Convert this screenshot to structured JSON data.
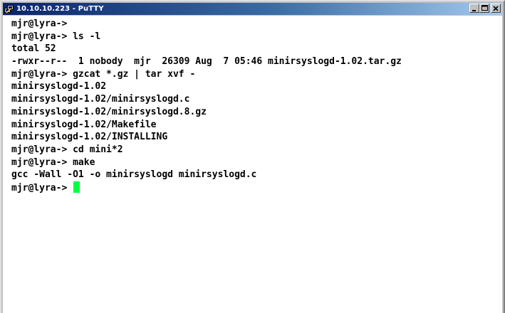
{
  "window": {
    "title": "10.10.10.223 - PuTTY",
    "icon": "putty-icon",
    "controls": [
      "minimize-icon",
      "maximize-icon",
      "close-icon"
    ]
  },
  "terminal": {
    "background": "#ffffff",
    "foreground": "#000000",
    "cursor_color": "#00ff40",
    "lines": [
      "mjr@lyra->",
      "mjr@lyra-> ls -l",
      "total 52",
      "-rwxr--r--  1 nobody  mjr  26309 Aug  7 05:46 minirsyslogd-1.02.tar.gz",
      "mjr@lyra-> gzcat *.gz | tar xvf -",
      "minirsyslogd-1.02",
      "minirsyslogd-1.02/minirsyslogd.c",
      "minirsyslogd-1.02/minirsyslogd.8.gz",
      "minirsyslogd-1.02/Makefile",
      "minirsyslogd-1.02/INSTALLING",
      "mjr@lyra-> cd mini*2",
      "mjr@lyra-> make",
      "gcc -Wall -O1 -o minirsyslogd minirsyslogd.c"
    ],
    "prompt": "mjr@lyra-> "
  }
}
